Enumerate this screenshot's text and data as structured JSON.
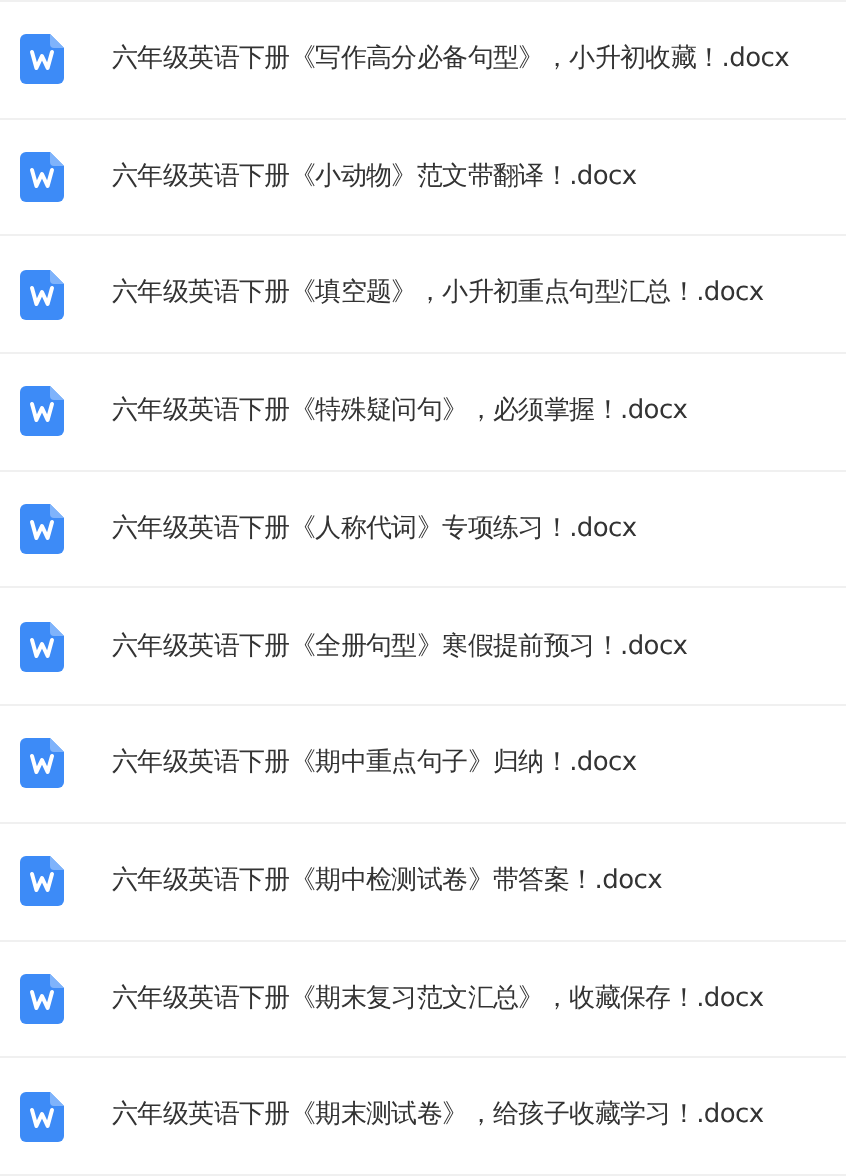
{
  "files": [
    {
      "name": "六年级英语下册《写作高分必备句型》，小升初收藏！.docx"
    },
    {
      "name": "六年级英语下册《小动物》范文带翻译！.docx"
    },
    {
      "name": "六年级英语下册《填空题》，小升初重点句型汇总！.docx"
    },
    {
      "name": "六年级英语下册《特殊疑问句》，必须掌握！.docx"
    },
    {
      "name": "六年级英语下册《人称代词》专项练习！.docx"
    },
    {
      "name": "六年级英语下册《全册句型》寒假提前预习！.docx"
    },
    {
      "name": "六年级英语下册《期中重点句子》归纳！.docx"
    },
    {
      "name": "六年级英语下册《期中检测试卷》带答案！.docx"
    },
    {
      "name": "六年级英语下册《期末复习范文汇总》，收藏保存！.docx"
    },
    {
      "name": "六年级英语下册《期末测试卷》，给孩子收藏学习！.docx"
    }
  ]
}
